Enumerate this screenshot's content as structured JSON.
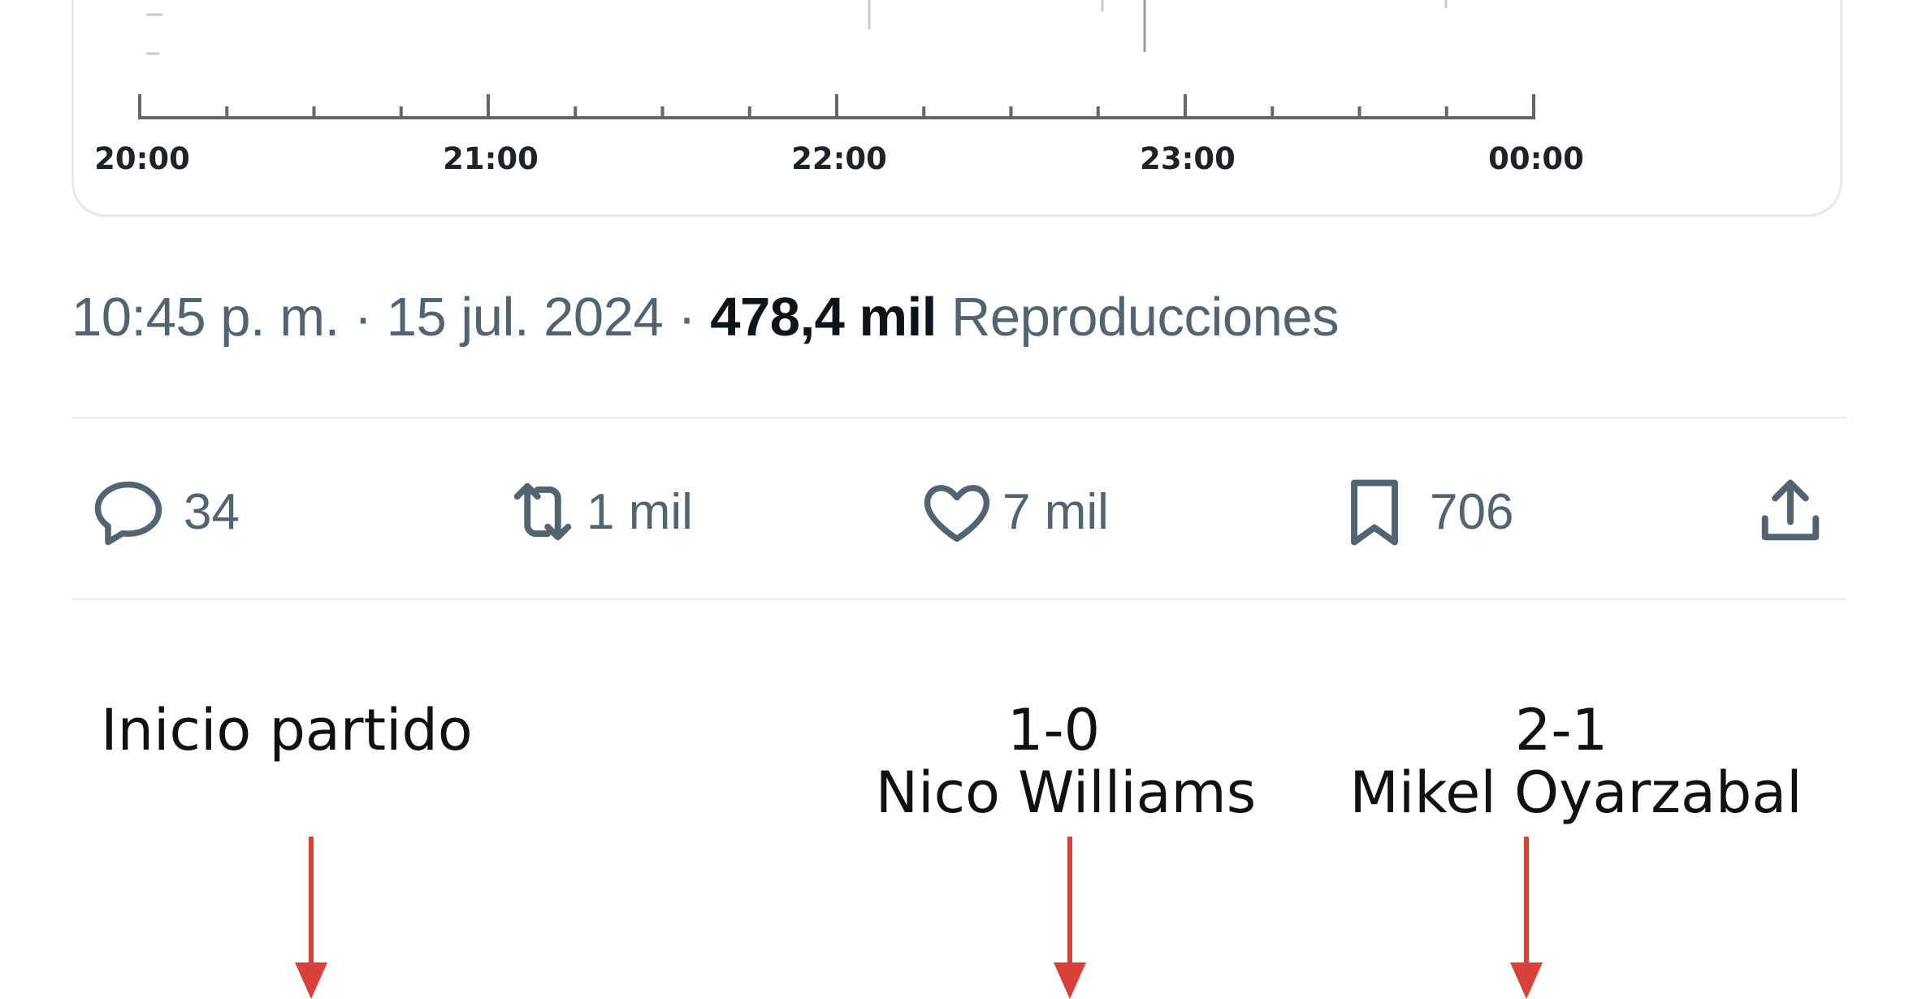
{
  "chart": {
    "tick_labels": [
      "20:00",
      "21:00",
      "22:00",
      "23:00",
      "00:00"
    ]
  },
  "tweet": {
    "time": "10:45 p. m.",
    "separator": "·",
    "date": "15 jul. 2024",
    "views_count": "478,4 mil",
    "views_label": "Reproducciones"
  },
  "actions": {
    "replies": {
      "icon": "reply-icon",
      "count": "34"
    },
    "retweets": {
      "icon": "retweet-icon",
      "count": "1 mil"
    },
    "likes": {
      "icon": "heart-icon",
      "count": "7 mil"
    },
    "bookmarks": {
      "icon": "bookmark-icon",
      "count": "706"
    },
    "share": {
      "icon": "share-icon"
    }
  },
  "annotations": {
    "start": "Inicio partido",
    "goal1_score": "1-0",
    "goal1_player": "Nico Williams",
    "goal2_score": "2-1",
    "goal2_player": "Mikel Oyarzabal"
  },
  "colors": {
    "arrow": "#d9413a",
    "muted": "#536471",
    "axis": "#666666"
  }
}
